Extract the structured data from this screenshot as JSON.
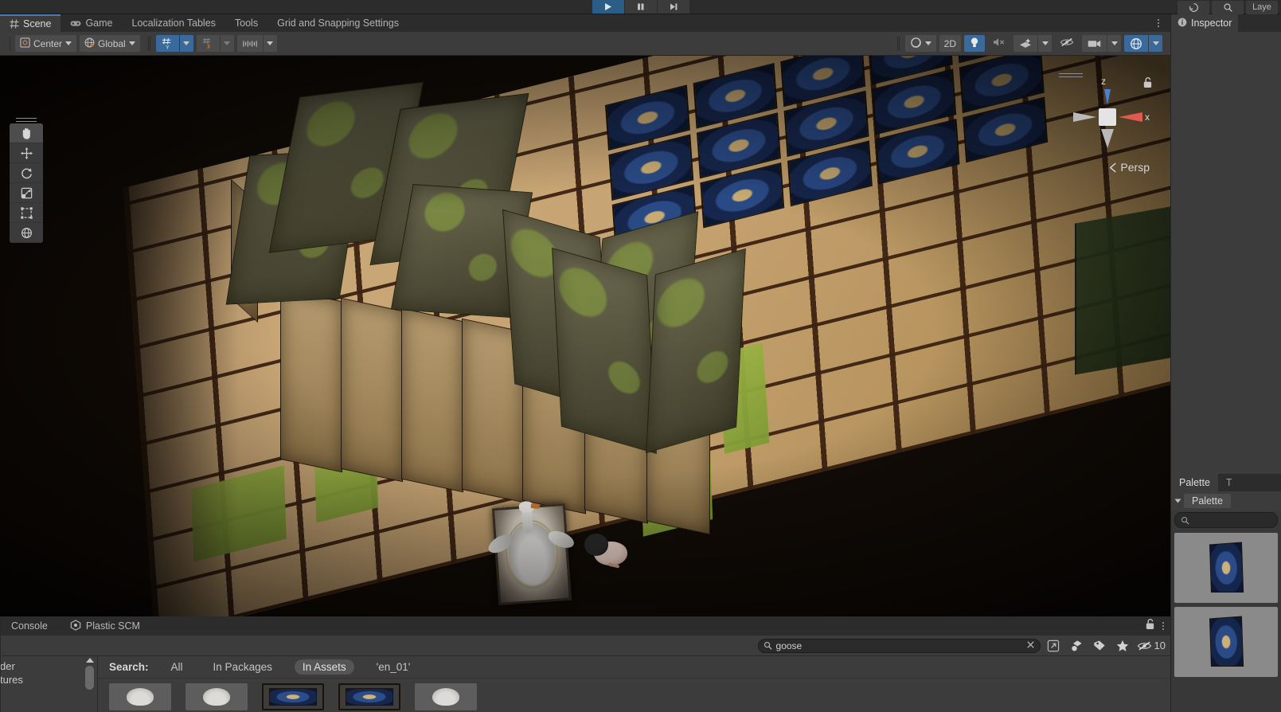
{
  "topbar": {
    "play_controls": [
      {
        "name": "play-button",
        "state": "active"
      },
      {
        "name": "pause-button",
        "state": "normal"
      },
      {
        "name": "step-button",
        "state": "normal"
      }
    ],
    "right_items": [
      {
        "name": "cloud-button",
        "label": ""
      },
      {
        "name": "search-button",
        "label": ""
      },
      {
        "name": "layers-dropdown",
        "label": "Laye"
      }
    ]
  },
  "scene_panel": {
    "tabs": [
      {
        "label": "Scene",
        "icon": "grid-icon",
        "active": true
      },
      {
        "label": "Game",
        "icon": "gamepad-icon",
        "active": false
      },
      {
        "label": "Localization Tables",
        "icon": "",
        "active": false
      },
      {
        "label": "Tools",
        "icon": "",
        "active": false
      },
      {
        "label": "Grid and Snapping Settings",
        "icon": "",
        "active": false
      }
    ],
    "toolbar": {
      "pivot_mode": "Center",
      "pivot_rotation": "Global",
      "grid_axis": "Y",
      "right_controls": [
        {
          "name": "shading-mode-dropdown",
          "label": "",
          "active": false
        },
        {
          "name": "2d-toggle",
          "label": "2D",
          "active": false
        },
        {
          "name": "lighting-toggle",
          "label": "",
          "active": true
        },
        {
          "name": "audio-toggle",
          "label": "",
          "active": false
        },
        {
          "name": "effects-dropdown",
          "label": "",
          "active": false
        },
        {
          "name": "hidden-objects-toggle",
          "label": "",
          "active": false
        },
        {
          "name": "camera-dropdown",
          "label": "",
          "active": false
        },
        {
          "name": "gizmos-dropdown",
          "label": "",
          "active": true
        }
      ]
    },
    "tools": [
      {
        "name": "hand-tool",
        "active": true
      },
      {
        "name": "move-tool",
        "active": false
      },
      {
        "name": "rotate-tool",
        "active": false
      },
      {
        "name": "scale-tool",
        "active": false
      },
      {
        "name": "rect-tool",
        "active": false
      },
      {
        "name": "transform-tool",
        "active": false
      }
    ],
    "gizmo": {
      "axis_z_label": "z",
      "axis_x_label": "x",
      "projection_label": "Persp",
      "color_z": "#4a7fd4",
      "color_x": "#e05b4f",
      "color_neutral": "#b9b9b9"
    }
  },
  "right_column": {
    "inspector_tab": {
      "label": "Inspector",
      "icon": "info-icon"
    },
    "palette": {
      "tab_label": "Palette",
      "secondary_tab_label": "T",
      "selected_palette": "Palette",
      "search_placeholder": "",
      "tiles": [
        {
          "name": "palette-tile-rug-1"
        },
        {
          "name": "palette-tile-rug-2"
        }
      ]
    }
  },
  "bottom": {
    "tabs": [
      {
        "label": "Console",
        "icon": ""
      },
      {
        "label": "Plastic SCM",
        "icon": "plastic-icon"
      }
    ],
    "project": {
      "search_value": "goose",
      "search_placeholder": "Search",
      "hidden_count": "10",
      "filter_label": "Search:",
      "filters": [
        {
          "label": "All",
          "active": false
        },
        {
          "label": "In Packages",
          "active": false
        },
        {
          "label": "In Assets",
          "active": true
        },
        {
          "label": "'en_01'",
          "active": false
        }
      ],
      "tree_items": [
        "der",
        "tures"
      ],
      "assets": [
        {
          "name": "asset-goose-1",
          "kind": "goose"
        },
        {
          "name": "asset-goose-2",
          "kind": "goose"
        },
        {
          "name": "asset-rug-1",
          "kind": "rug"
        },
        {
          "name": "asset-rug-2",
          "kind": "rug"
        },
        {
          "name": "asset-goose-3",
          "kind": "goose"
        }
      ]
    }
  },
  "scene_content": {
    "goose_card_name": "goose-card-object",
    "chicken_name": "chicken-object"
  }
}
